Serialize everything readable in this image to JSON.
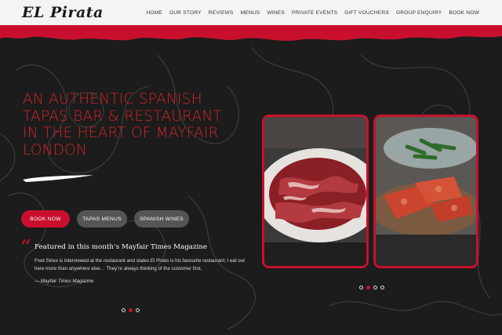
{
  "brand": {
    "logo_text": "EL Pirata"
  },
  "nav": {
    "items": [
      "HOME",
      "OUR STORY",
      "REVIEWS",
      "MENUS",
      "WINES",
      "PRIVATE EVENTS",
      "GIFT VOUCHERS",
      "GROUP ENQUIRY",
      "BOOK NOW"
    ]
  },
  "hero": {
    "title": "AN AUTHENTIC SPANISH TAPAS BAR & RESTAURANT IN THE HEART OF MAYFAIR LONDON",
    "buttons": {
      "book": "BOOK NOW",
      "tapas": "TAPAS MENUS",
      "wines": "SPANISH WINES"
    }
  },
  "testimonial": {
    "quote_mark": "“",
    "heading": "Featured in this month’s Mayfair Times Magazine",
    "body": "Fred Siriex is interviewed at the restaurant and states El Pirato is his favourite restaurant; I eat out here more than anywhere else… They’re always thinking of the customer first.",
    "source": "— Mayfair Times Magazine"
  },
  "carousel_left": {
    "count": 3,
    "active_index": 1
  },
  "carousel_right": {
    "count": 4,
    "active_index": 1
  },
  "photos": [
    {
      "icon": "jamon-plate-image"
    },
    {
      "icon": "pan-con-tomate-image"
    }
  ],
  "colors": {
    "accent": "#c8102e",
    "title_red": "#d2232a",
    "background": "#1c1c1c",
    "topbar": "#f4f4f4",
    "secondary_button": "#555555"
  }
}
